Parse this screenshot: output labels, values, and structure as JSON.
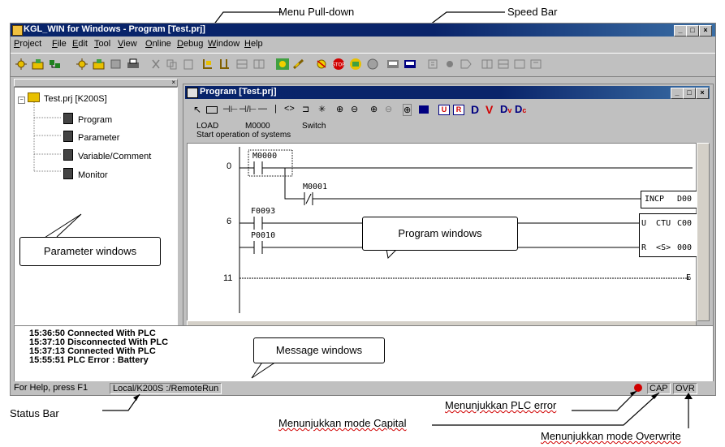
{
  "annotations": {
    "menu_pulldown": "Menu Pull-down",
    "speed_bar": "Speed Bar",
    "status_bar": "Status Bar",
    "plc_error": "Menunjukkan PLC error",
    "capital": "Menunjukkan mode Capital",
    "overwrite": "Menunjukkan mode Overwrite",
    "parameter_windows": "Parameter windows",
    "program_windows": "Program windows",
    "message_windows": "Message windows"
  },
  "app": {
    "title": "KGL_WIN for Windows - Program [Test.prj]"
  },
  "menu": [
    "Project",
    "File",
    "Edit",
    "Tool",
    "View",
    "Online",
    "Debug",
    "Window",
    "Help"
  ],
  "tree": {
    "root": "Test.prj [K200S]",
    "items": [
      "Program",
      "Parameter",
      "Variable/Comment",
      "Monitor"
    ]
  },
  "program": {
    "title": "Program [Test.prj]",
    "info_row1": [
      "LOAD",
      "M0000",
      "Switch"
    ],
    "info_row2": "Start operation of systems",
    "rungs": [
      "0",
      "6",
      "11"
    ],
    "contacts": [
      "M0000",
      "M0001",
      "F0093",
      "P0010"
    ],
    "outputs": [
      "INCP",
      "D00",
      "U  CTU",
      "C00",
      "R  <S>",
      "000",
      "E"
    ],
    "tool_letters": [
      "D",
      "V",
      "D",
      "D"
    ]
  },
  "messages": [
    "15:36:50 Connected With PLC",
    "15:37:10 Disconnected With PLC",
    "15:37:13 Connected With PLC",
    "15:55:51 PLC Error : Battery"
  ],
  "status": {
    "help": "For Help, press F1",
    "mode": "Local/K200S :/RemoteRun",
    "cap": "CAP",
    "ovr": "OVR"
  }
}
